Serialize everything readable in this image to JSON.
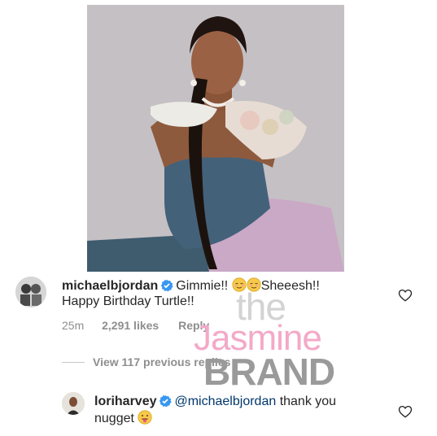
{
  "comments": [
    {
      "username": "michaelbjordan",
      "text_line1_a": "Gimmie!!",
      "text_line1_b": "Sheeesh!!",
      "text_line2": "Happy Birthday Turtle!!",
      "age": "25m",
      "likes": "2,291 likes",
      "reply_label": "Reply",
      "icons": [
        "verified-badge-icon",
        "relieved-face-emoji",
        "relieved-face-emoji",
        "heart-outline-icon"
      ]
    }
  ],
  "view_replies": "View 117 previous replies",
  "reply": {
    "username": "loriharvey",
    "mention": "@michaelbjordan",
    "text_a": "thank you",
    "text_b": "nugget",
    "icons": [
      "verified-badge-icon",
      "tongue-face-emoji",
      "heart-outline-icon"
    ]
  },
  "watermark": {
    "the": "the",
    "jasmine": "Jasmine",
    "brand": "BRAND"
  },
  "colors": {
    "text": "#262626",
    "muted": "#8e8e8e",
    "verified": "#3897f0",
    "mention": "#00376b"
  }
}
